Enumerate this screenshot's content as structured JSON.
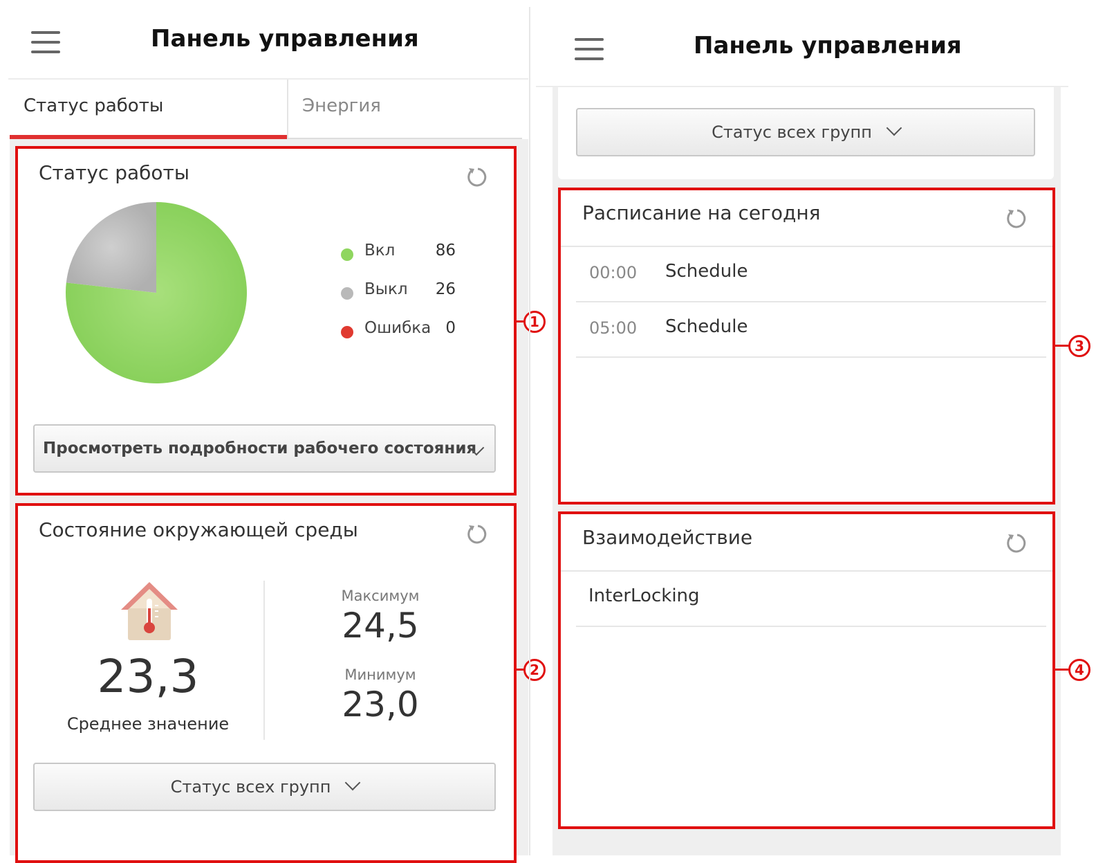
{
  "left_panel": {
    "header": {
      "title": "Панель управления"
    },
    "tabs": [
      {
        "label": "Статус работы",
        "active": true
      },
      {
        "label": "Энергия",
        "active": false
      }
    ],
    "work_status": {
      "title": "Статус работы",
      "legend": [
        {
          "label": "Вкл",
          "value": "86",
          "color": "#8fd65f"
        },
        {
          "label": "Выкл",
          "value": "26",
          "color": "#b9b9b9"
        },
        {
          "label": "Ошибка",
          "value": "0",
          "color": "#e03a30"
        }
      ],
      "details_button": "Просмотреть подробности рабочего состояния"
    },
    "environment": {
      "title": "Состояние окружающей среды",
      "average_value": "23,3",
      "average_label": "Среднее значение",
      "max_label": "Максимум",
      "max_value": "24,5",
      "min_label": "Минимум",
      "min_value": "23,0",
      "groups_button": "Статус всех групп"
    }
  },
  "right_panel": {
    "header": {
      "title": "Панель управления"
    },
    "groups_button": "Статус всех групп",
    "schedule": {
      "title": "Расписание на сегодня",
      "items": [
        {
          "time": "00:00",
          "name": "Schedule"
        },
        {
          "time": "05:00",
          "name": "Schedule"
        }
      ]
    },
    "interlocking": {
      "title": "Взаимодействие",
      "items": [
        {
          "name": "InterLocking"
        }
      ]
    }
  },
  "callouts": [
    "1",
    "2",
    "3",
    "4"
  ],
  "colors": {
    "accent": "#e03030",
    "callout": "#e01010",
    "on": "#8fd65f",
    "off": "#b9b9b9",
    "error": "#e03a30"
  },
  "chart_data": {
    "type": "pie",
    "categories": [
      "Вкл",
      "Выкл",
      "Ошибка"
    ],
    "values": [
      86,
      26,
      0
    ],
    "title": ""
  }
}
